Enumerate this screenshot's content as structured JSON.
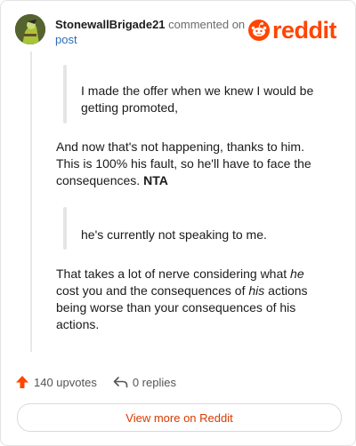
{
  "header": {
    "username": "StonewallBrigade21",
    "action_text": "commented on",
    "post_link": "post",
    "brand": "reddit"
  },
  "comment": {
    "quote1": "I made the offer when we knew I would be getting promoted,",
    "para1_text": "And now that's not happening, thanks to him. This is 100% his fault, so he'll have to face the consequences. ",
    "para1_bold": "NTA",
    "quote2": "he's currently not speaking to me.",
    "para2_a": "That takes a lot of nerve considering what ",
    "para2_em1": "he",
    "para2_b": " cost you and the consequences of ",
    "para2_em2": "his",
    "para2_c": " actions being worse than your consequences of his actions."
  },
  "footer": {
    "upvotes": "140 upvotes",
    "replies": "0 replies",
    "view_more": "View more on Reddit"
  },
  "colors": {
    "brand": "#ff4500",
    "upvote": "#ff4500",
    "link": "#2b6fb6",
    "view_more_text": "#d93a00"
  },
  "icons": {
    "upvote": "arrow-up-icon",
    "reply": "reply-arrow-icon",
    "logo": "reddit-snoo-icon"
  }
}
